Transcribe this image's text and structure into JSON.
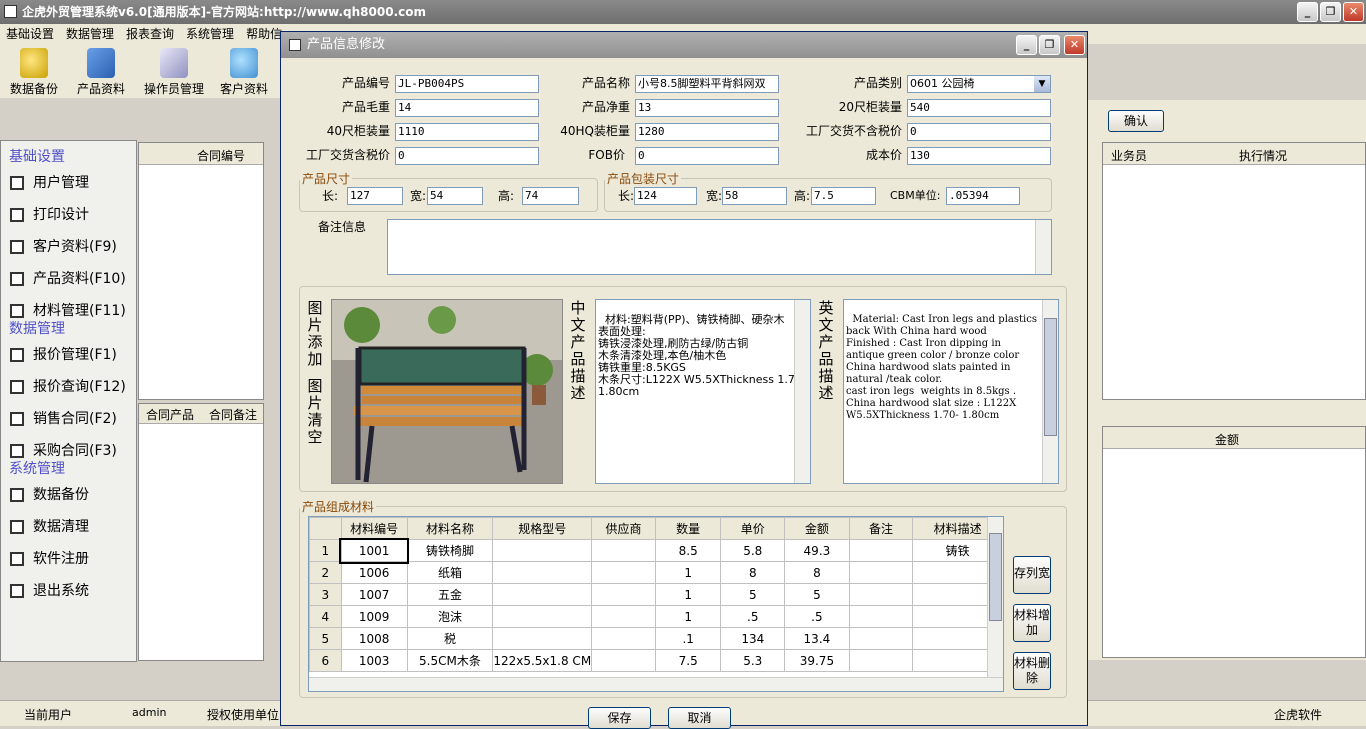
{
  "app": {
    "title": "企虎外贸管理系统v6.0[通用版本]-官方网站:http://www.qh8000.com"
  },
  "menu": [
    "基础设置",
    "数据管理",
    "报表查询",
    "系统管理",
    "帮助信"
  ],
  "toolbar": [
    {
      "label": "数据备份",
      "icon": "database-backup-icon"
    },
    {
      "label": "产品资料",
      "icon": "product-icon"
    },
    {
      "label": "操作员管理",
      "icon": "operator-icon"
    },
    {
      "label": "客户资料",
      "icon": "customer-icon"
    }
  ],
  "sidebar": {
    "groups": [
      {
        "title": "基础设置",
        "items": [
          "用户管理",
          "打印设计",
          "客户资料(F9)",
          "产品资料(F10)",
          "材料管理(F11)"
        ]
      },
      {
        "title": "数据管理",
        "items": [
          "报价管理(F1)",
          "报价查询(F12)",
          "销售合同(F2)",
          "采购合同(F3)"
        ]
      },
      {
        "title": "系统管理",
        "items": [
          "数据备份",
          "数据清理",
          "软件注册",
          "退出系统"
        ]
      }
    ]
  },
  "background": {
    "contract_no_header": "合同编号",
    "confirm_button": "确认",
    "salesman_header": "业务员",
    "status_header": "执行情况",
    "tab_products": "合同产品",
    "tab_notes": "合同备注",
    "amount_header": "金额"
  },
  "status": {
    "current_user_label": "当前用户",
    "current_user": "admin",
    "license_label": "授权使用单位",
    "company": "企虎软件"
  },
  "dialog": {
    "title": "产品信息修改",
    "fields": {
      "product_code": {
        "label": "产品编号",
        "value": "JL-PB004PS"
      },
      "product_name": {
        "label": "产品名称",
        "value": "小号8.5脚塑料平背斜网双"
      },
      "category": {
        "label": "产品类别",
        "value": "0601   公园椅"
      },
      "gross_weight": {
        "label": "产品毛重",
        "value": "14"
      },
      "net_weight": {
        "label": "产品净重",
        "value": "13"
      },
      "ft20": {
        "label": "20尺柜装量",
        "value": "540"
      },
      "ft40": {
        "label": "40尺柜装量",
        "value": "1110"
      },
      "hq40": {
        "label": "40HQ装柜量",
        "value": "1280"
      },
      "price_ex_tax": {
        "label": "工厂交货不含税价",
        "value": "0"
      },
      "price_inc_tax": {
        "label": "工厂交货含税价",
        "value": "0"
      },
      "fob": {
        "label": "FOB价",
        "value": "0"
      },
      "cost": {
        "label": "成本价",
        "value": "130"
      }
    },
    "size": {
      "legend": "产品尺寸",
      "l_label": "长:",
      "l": "127",
      "w_label": "宽:",
      "w": "54",
      "h_label": "高:",
      "h": "74"
    },
    "pack": {
      "legend": "产品包装尺寸",
      "l_label": "长:",
      "l": "124",
      "w_label": "宽:",
      "w": "58",
      "h_label": "高:",
      "h": "7.5",
      "cbm_label": "CBM单位:",
      "cbm": ".05394"
    },
    "notes_label": "备注信息",
    "image_add": "图片添加",
    "image_clear": "图片清空",
    "cn_desc_label": "中文产品描述",
    "cn_desc": "材料:塑料背(PP)、铸铁椅脚、硬杂木\n表面处理:\n铸铁浸漆处理,刷防古绿/防古铜\n木条清漆处理,本色/柚木色\n铸铁重里:8.5KGS\n木条尺寸:L122X W5.5XThickness 1.70- 1.80cm",
    "en_desc_label": "英文产品描述",
    "en_desc": "Material: Cast Iron legs and plastics back With China hard wood\nFinished : Cast Iron dipping in antique green color / bronze color\nChina hardwood slats painted in natural /teak color.\ncast iron legs  weights in 8.5kgs .\nChina hardwood slat size : L122X W5.5XThickness 1.70- 1.80cm",
    "materials_legend": "产品组成材料",
    "materials_headers": [
      "材料编号",
      "材料名称",
      "规格型号",
      "供应商",
      "数量",
      "单价",
      "金额",
      "备注",
      "材料描述"
    ],
    "materials_rows": [
      [
        "1",
        "1001",
        "铸铁椅脚",
        "",
        "",
        "8.5",
        "5.8",
        "49.3",
        "",
        "铸铁"
      ],
      [
        "2",
        "1006",
        "纸箱",
        "",
        "",
        "1",
        "8",
        "8",
        "",
        ""
      ],
      [
        "3",
        "1007",
        "五金",
        "",
        "",
        "1",
        "5",
        "5",
        "",
        ""
      ],
      [
        "4",
        "1009",
        "泡沫",
        "",
        "",
        "1",
        ".5",
        ".5",
        "",
        ""
      ],
      [
        "5",
        "1008",
        "税",
        "",
        "",
        ".1",
        "134",
        "13.4",
        "",
        ""
      ],
      [
        "6",
        "1003",
        "5.5CM木条",
        "122x5.5x1.8 CM",
        "",
        "7.5",
        "5.3",
        "39.75",
        "",
        ""
      ]
    ],
    "btn_save_width": "存列宽",
    "btn_add_material": "材料增加",
    "btn_del_material": "材料删除",
    "btn_save": "保存",
    "btn_cancel": "取消"
  }
}
